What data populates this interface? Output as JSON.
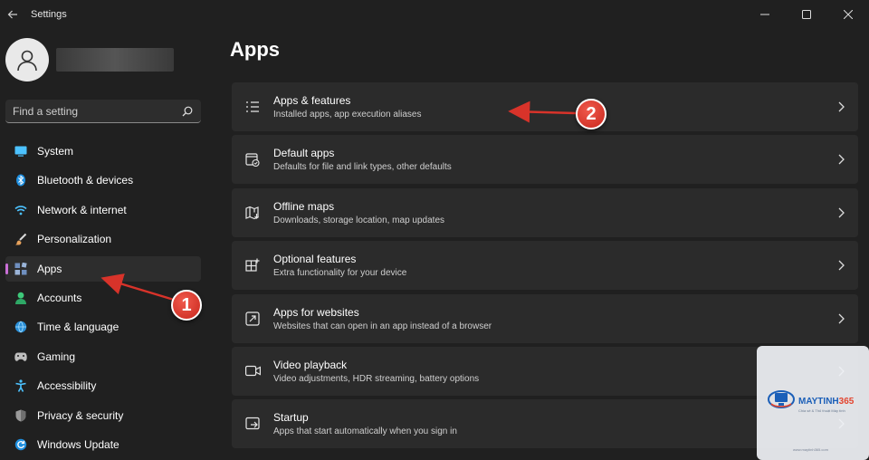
{
  "window": {
    "title": "Settings",
    "controls": [
      "minimize",
      "maximize",
      "close"
    ]
  },
  "search": {
    "placeholder": "Find a setting",
    "value": ""
  },
  "sidebar": {
    "selected": "Apps",
    "items": [
      {
        "label": "System",
        "icon": "monitor-icon",
        "color": "#4cc2ff"
      },
      {
        "label": "Bluetooth & devices",
        "icon": "bluetooth-icon",
        "color": "#4cc2ff"
      },
      {
        "label": "Network & internet",
        "icon": "wifi-icon",
        "color": "#4cc2ff"
      },
      {
        "label": "Personalization",
        "icon": "brush-icon",
        "color": "#e6a15b"
      },
      {
        "label": "Apps",
        "icon": "apps-icon",
        "color": "#9ab4d8"
      },
      {
        "label": "Accounts",
        "icon": "person-icon",
        "color": "#3ec97a"
      },
      {
        "label": "Time & language",
        "icon": "globe-clock-icon",
        "color": "#4cc2ff"
      },
      {
        "label": "Gaming",
        "icon": "gamepad-icon",
        "color": "#bfbfbf"
      },
      {
        "label": "Accessibility",
        "icon": "accessibility-icon",
        "color": "#4cc2ff"
      },
      {
        "label": "Privacy & security",
        "icon": "shield-icon",
        "color": "#9a9a9a"
      },
      {
        "label": "Windows Update",
        "icon": "update-icon",
        "color": "#4cc2ff"
      }
    ]
  },
  "main": {
    "title": "Apps",
    "cards": [
      {
        "title": "Apps & features",
        "subtitle": "Installed apps, app execution aliases",
        "icon": "list-icon"
      },
      {
        "title": "Default apps",
        "subtitle": "Defaults for file and link types, other defaults",
        "icon": "default-apps-icon"
      },
      {
        "title": "Offline maps",
        "subtitle": "Downloads, storage location, map updates",
        "icon": "map-icon"
      },
      {
        "title": "Optional features",
        "subtitle": "Extra functionality for your device",
        "icon": "add-grid-icon"
      },
      {
        "title": "Apps for websites",
        "subtitle": "Websites that can open in an app instead of a browser",
        "icon": "open-external-icon"
      },
      {
        "title": "Video playback",
        "subtitle": "Video adjustments, HDR streaming, battery options",
        "icon": "video-icon"
      },
      {
        "title": "Startup",
        "subtitle": "Apps that start automatically when you sign in",
        "icon": "startup-icon"
      }
    ]
  },
  "annotations": [
    {
      "number": "1"
    },
    {
      "number": "2"
    }
  ],
  "watermark": {
    "brand_main": "MAYTINH",
    "brand_num": "365",
    "tagline": "Chia sẻ & Thủ thuật Máy tính",
    "url": "www.maytinh365.com"
  },
  "colors": {
    "background": "#202020",
    "card": "#2b2b2b",
    "accent": "#c96fd6",
    "annotation": "#d8332a"
  }
}
